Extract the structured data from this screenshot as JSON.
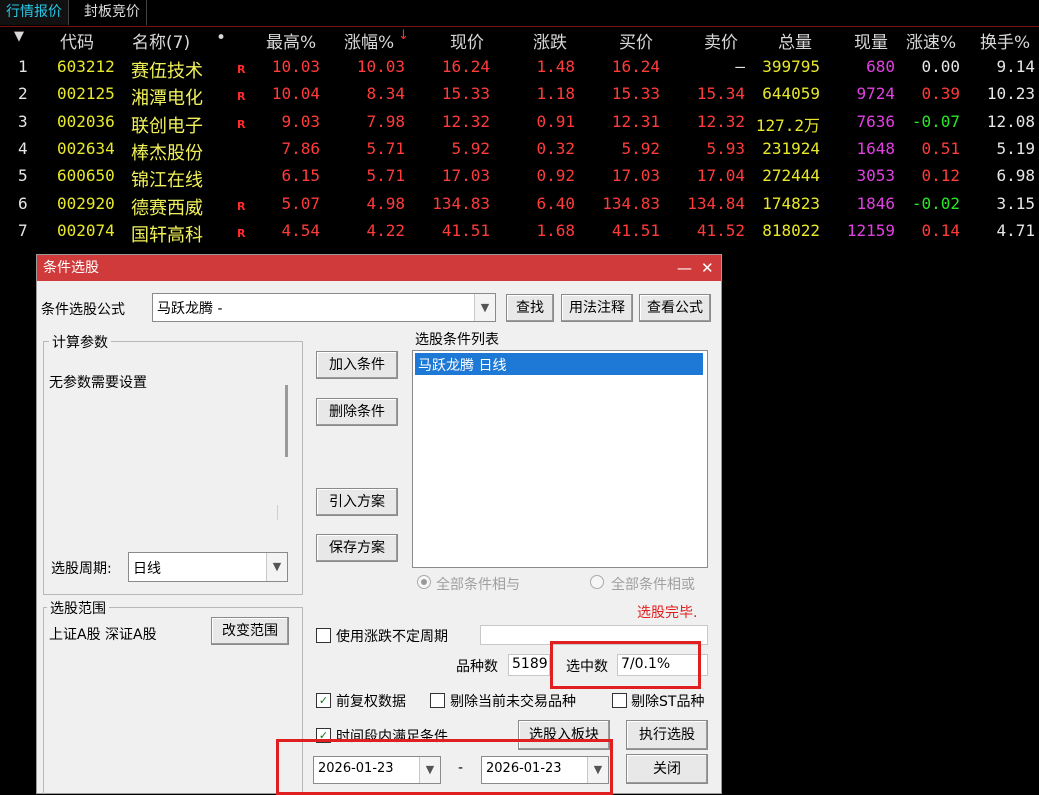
{
  "tabs": [
    "行情报价",
    "封板竞价"
  ],
  "table": {
    "sort_arrow": "▼",
    "headers": [
      "代码",
      "名称(7)",
      "•",
      "最高%",
      "涨幅%",
      "↓",
      "现价",
      "涨跌",
      "买价",
      "卖价",
      "总量",
      "现量",
      "涨速%",
      "换手%"
    ],
    "rows": [
      {
        "idx": "1",
        "code": "603212",
        "name": "赛伍技术",
        "flag": "R",
        "high": "10.03",
        "pct": "10.03",
        "price": "16.24",
        "chg": "1.48",
        "bid": "16.24",
        "ask": "—",
        "vol": "399795",
        "cur": "680",
        "speed": "0.00",
        "turn": "9.14"
      },
      {
        "idx": "2",
        "code": "002125",
        "name": "湘潭电化",
        "flag": "R",
        "high": "10.04",
        "pct": "8.34",
        "price": "15.33",
        "chg": "1.18",
        "bid": "15.33",
        "ask": "15.34",
        "vol": "644059",
        "cur": "9724",
        "speed": "0.39",
        "turn": "10.23"
      },
      {
        "idx": "3",
        "code": "002036",
        "name": "联创电子",
        "flag": "R",
        "high": "9.03",
        "pct": "7.98",
        "price": "12.32",
        "chg": "0.91",
        "bid": "12.31",
        "ask": "12.32",
        "vol": "127.2万",
        "cur": "7636",
        "speed": "-0.07",
        "turn": "12.08"
      },
      {
        "idx": "4",
        "code": "002634",
        "name": "棒杰股份",
        "flag": "",
        "high": "7.86",
        "pct": "5.71",
        "price": "5.92",
        "chg": "0.32",
        "bid": "5.92",
        "ask": "5.93",
        "vol": "231924",
        "cur": "1648",
        "speed": "0.51",
        "turn": "5.19"
      },
      {
        "idx": "5",
        "code": "600650",
        "name": "锦江在线",
        "flag": "",
        "high": "6.15",
        "pct": "5.71",
        "price": "17.03",
        "chg": "0.92",
        "bid": "17.03",
        "ask": "17.04",
        "vol": "272444",
        "cur": "3053",
        "speed": "0.12",
        "turn": "6.98"
      },
      {
        "idx": "6",
        "code": "002920",
        "name": "德赛西威",
        "flag": "R",
        "high": "5.07",
        "pct": "4.98",
        "price": "134.83",
        "chg": "6.40",
        "bid": "134.83",
        "ask": "134.84",
        "vol": "174823",
        "cur": "1846",
        "speed": "-0.02",
        "turn": "3.15"
      },
      {
        "idx": "7",
        "code": "002074",
        "name": "国轩高科",
        "flag": "R",
        "high": "4.54",
        "pct": "4.22",
        "price": "41.51",
        "chg": "1.68",
        "bid": "41.51",
        "ask": "41.52",
        "vol": "818022",
        "cur": "12159",
        "speed": "0.14",
        "turn": "4.71"
      }
    ]
  },
  "dialog": {
    "title": "条件选股",
    "min_icon": "—",
    "close_icon": "✕",
    "formula_label": "条件选股公式",
    "formula_value": "马跃龙腾  -",
    "find_btn": "查找",
    "usage_btn": "用法注释",
    "view_btn": "查看公式",
    "params_group": "计算参数",
    "params_text": "无参数需要设置",
    "add_btn": "加入条件",
    "delete_btn": "删除条件",
    "import_btn": "引入方案",
    "save_btn": "保存方案",
    "cond_list_label": "选股条件列表",
    "cond_items": [
      "马跃龙腾  日线"
    ],
    "period_label": "选股周期:",
    "period_value": "日线",
    "radio_and": "全部条件相与",
    "radio_or": "全部条件相或",
    "status": "选股完毕.",
    "scope_group": "选股范围",
    "scope_text": "上证A股 深证A股",
    "change_scope_btn": "改变范围",
    "use_period_label": "使用涨跌不定周期",
    "count_label": "品种数",
    "count_value": "5189",
    "selected_label": "选中数",
    "selected_value": "7/0.1%",
    "prior_adj_label": "前复权数据",
    "exclude_untraded_label": "剔除当前未交易品种",
    "exclude_st_label": "剔除ST品种",
    "time_range_label": "时间段内满足条件",
    "to_block_btn": "选股入板块",
    "run_btn": "执行选股",
    "close_btn": "关闭",
    "date_from": "2026-01-23",
    "date_sep": "-",
    "date_to": "2026-01-23",
    "check_prior_adj": true,
    "check_time_range": true,
    "highlight_color": "#e02020"
  }
}
